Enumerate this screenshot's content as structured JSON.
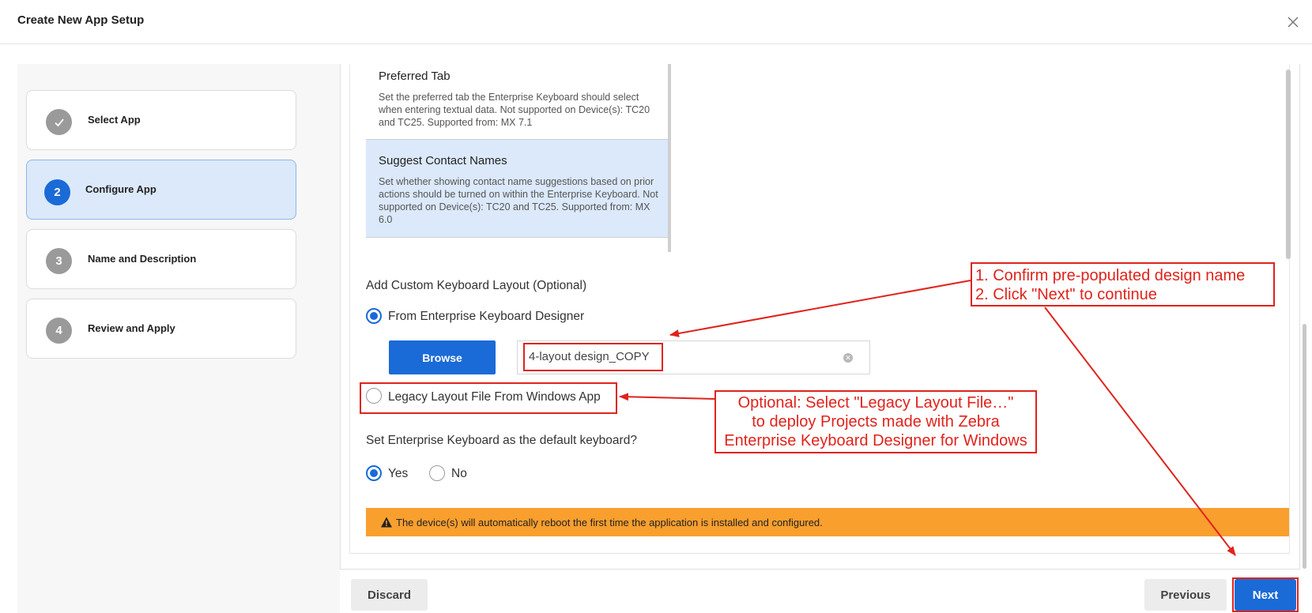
{
  "header": {
    "title": "Create New App Setup"
  },
  "steps": [
    {
      "number": "",
      "label": "Select App",
      "state": "completed"
    },
    {
      "number": "2",
      "label": "Configure App",
      "state": "active"
    },
    {
      "number": "3",
      "label": "Name and Description",
      "state": "pending"
    },
    {
      "number": "4",
      "label": "Review and Apply",
      "state": "pending"
    }
  ],
  "list": {
    "items": [
      {
        "title": "Preferred Tab",
        "desc": "Set the preferred tab the Enterprise Keyboard should select when entering textual data. Not supported on Device(s): TC20 and TC25. Supported from: MX 7.1"
      },
      {
        "title": "Suggest Contact Names",
        "desc": "Set whether showing contact name suggestions based on prior actions should be turned on within the Enterprise Keyboard. Not supported on Device(s): TC20 and TC25. Supported from: MX 6.0"
      }
    ]
  },
  "custom_layout": {
    "heading": "Add Custom Keyboard Layout (Optional)",
    "option_designer": "From Enterprise Keyboard Designer",
    "browse_label": "Browse",
    "design_name": "4-layout design_COPY",
    "option_legacy": "Legacy Layout File From Windows App"
  },
  "default_keyboard": {
    "question": "Set Enterprise Keyboard as the default keyboard?",
    "yes_label": "Yes",
    "no_label": "No"
  },
  "warning": {
    "text": "The device(s) will automatically reboot the first time the application is installed and configured."
  },
  "footer": {
    "discard_label": "Discard",
    "previous_label": "Previous",
    "next_label": "Next"
  },
  "annotations": {
    "note1_line1": "1. Confirm pre-populated design name",
    "note1_line2": "2. Click \"Next\" to continue",
    "note2_line1": "Optional: Select \"Legacy Layout File…\"",
    "note2_line2": "to deploy Projects made with Zebra",
    "note2_line3": "Enterprise Keyboard Designer for Windows"
  },
  "colors": {
    "primary": "#1a6ad7",
    "warning": "#f99f2e",
    "annotation": "#e0231c",
    "active_step_bg": "#dbe9fb"
  }
}
